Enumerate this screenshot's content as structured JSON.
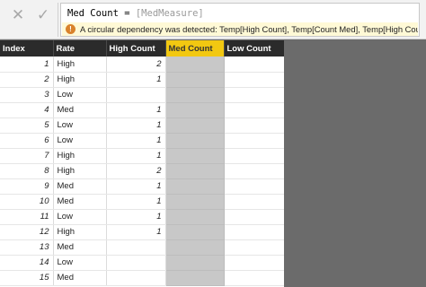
{
  "toolbar": {
    "cancel_icon": "close-icon",
    "commit_icon": "checkmark-icon",
    "formula_prefix": "Med Count = ",
    "formula_ref": "[MedMeasure]",
    "error_message": "A circular dependency was detected: Temp[High Count], Temp[Count Med], Temp[High Count]."
  },
  "table": {
    "headers": [
      "Index",
      "Rate",
      "High Count",
      "Med Count",
      "Low Count"
    ],
    "rows": [
      {
        "index": "1",
        "rate": "High",
        "high_count": "2"
      },
      {
        "index": "2",
        "rate": "High",
        "high_count": "1"
      },
      {
        "index": "3",
        "rate": "Low",
        "high_count": ""
      },
      {
        "index": "4",
        "rate": "Med",
        "high_count": "1"
      },
      {
        "index": "5",
        "rate": "Low",
        "high_count": "1"
      },
      {
        "index": "6",
        "rate": "Low",
        "high_count": "1"
      },
      {
        "index": "7",
        "rate": "High",
        "high_count": "1"
      },
      {
        "index": "8",
        "rate": "High",
        "high_count": "2"
      },
      {
        "index": "9",
        "rate": "Med",
        "high_count": "1"
      },
      {
        "index": "10",
        "rate": "Med",
        "high_count": "1"
      },
      {
        "index": "11",
        "rate": "Low",
        "high_count": "1"
      },
      {
        "index": "12",
        "rate": "High",
        "high_count": "1"
      },
      {
        "index": "13",
        "rate": "Med",
        "high_count": ""
      },
      {
        "index": "14",
        "rate": "Low",
        "high_count": ""
      },
      {
        "index": "15",
        "rate": "Med",
        "high_count": ""
      }
    ]
  },
  "colors": {
    "header_bg": "#2b2b2b",
    "selected_column_header": "#f2c811",
    "selected_column_cells": "#c8c8c8",
    "error_bg": "#fff9d6",
    "warning_icon": "#d9822b"
  }
}
